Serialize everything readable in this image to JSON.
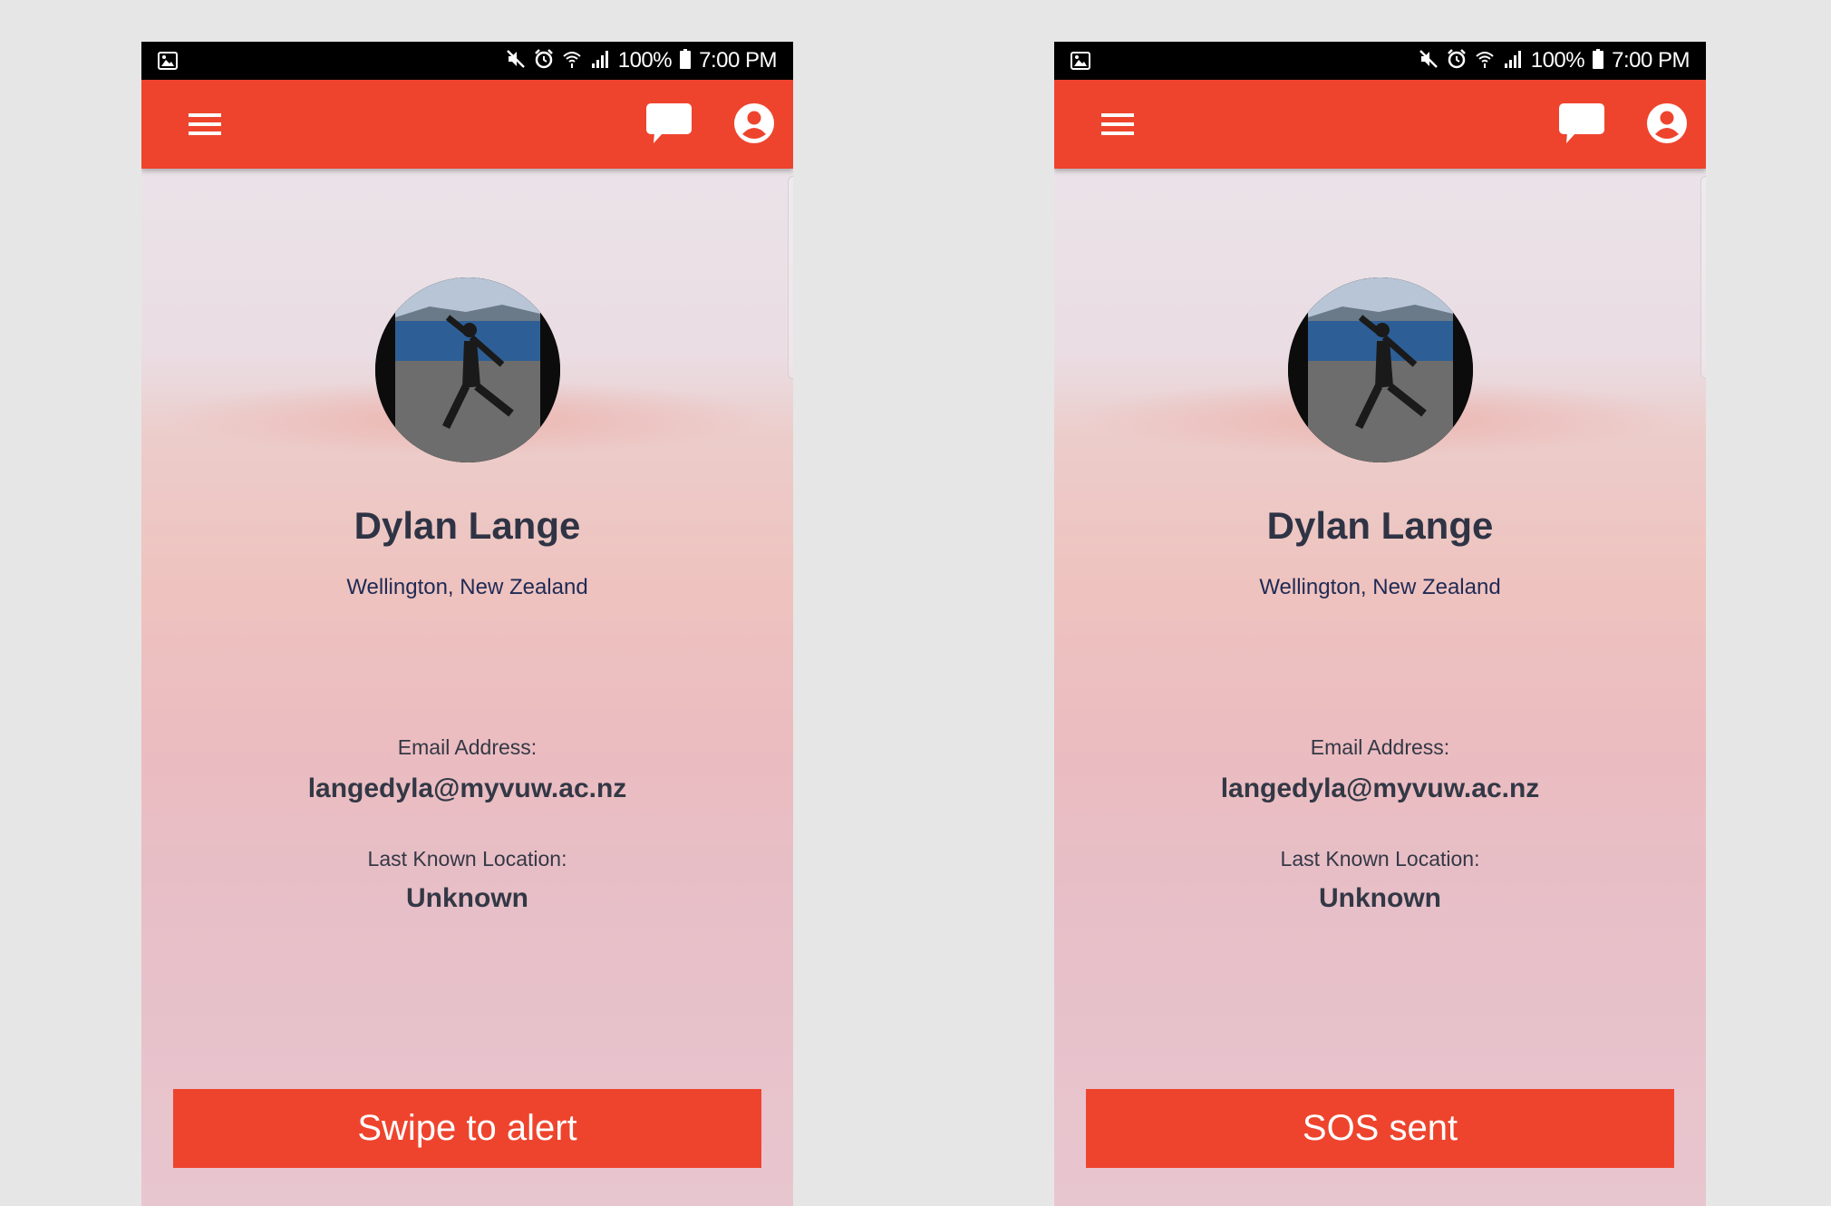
{
  "colors": {
    "brand_red": "#ee442e",
    "text_dark": "#333845",
    "name_color": "#2f3445",
    "location_color": "#1f2a55"
  },
  "screens": [
    {
      "status_bar": {
        "battery": "100%",
        "time": "7:00 PM",
        "icons": [
          "gallery-icon",
          "mute-icon",
          "alarm-icon",
          "wifi-icon",
          "signal-icon",
          "battery-icon"
        ]
      },
      "app_bar": {
        "icons": [
          "menu-icon",
          "chat-icon",
          "account-icon"
        ]
      },
      "profile": {
        "name": "Dylan Lange",
        "location": "Wellington, New Zealand",
        "email_label": "Email Address:",
        "email": "langedyla@myvuw.ac.nz",
        "last_location_label": "Last Known Location:",
        "last_location": "Unknown"
      },
      "action": {
        "label": "Swipe to alert"
      }
    },
    {
      "status_bar": {
        "battery": "100%",
        "time": "7:00 PM",
        "icons": [
          "gallery-icon",
          "mute-icon",
          "alarm-icon",
          "wifi-icon",
          "signal-icon",
          "battery-icon"
        ]
      },
      "app_bar": {
        "icons": [
          "menu-icon",
          "chat-icon",
          "account-icon"
        ]
      },
      "profile": {
        "name": "Dylan Lange",
        "location": "Wellington, New Zealand",
        "email_label": "Email Address:",
        "email": "langedyla@myvuw.ac.nz",
        "last_location_label": "Last Known Location:",
        "last_location": "Unknown"
      },
      "action": {
        "label": "SOS sent"
      }
    }
  ]
}
